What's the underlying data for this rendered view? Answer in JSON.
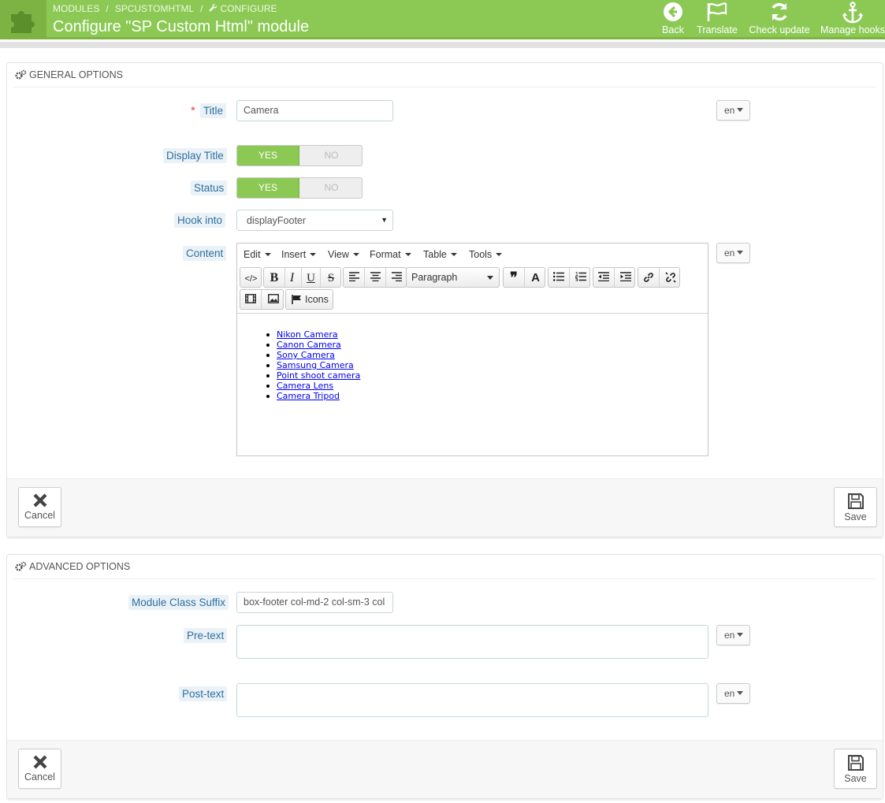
{
  "header": {
    "breadcrumb": [
      "MODULES",
      "SPCUSTOMHTML",
      "CONFIGURE"
    ],
    "title": "Configure \"SP Custom Html\" module",
    "actions": [
      {
        "label": "Back",
        "icon": "back-circle-icon"
      },
      {
        "label": "Translate",
        "icon": "flag-icon"
      },
      {
        "label": "Check update",
        "icon": "refresh-icon"
      },
      {
        "label": "Manage hooks",
        "icon": "anchor-icon"
      }
    ],
    "colors": {
      "bar": "#8bc954",
      "logo_bg": "#7cb342"
    }
  },
  "general": {
    "heading": "GENERAL OPTIONS",
    "title_label": "Title",
    "required_mark": "*",
    "title_value": "Camera",
    "lang": "en",
    "display_title_label": "Display Title",
    "status_label": "Status",
    "yes": "YES",
    "no": "NO",
    "hook_label": "Hook into",
    "hook_value": "displayFooter",
    "content_label": "Content",
    "editor": {
      "menu": [
        "Edit",
        "Insert",
        "View",
        "Format",
        "Table",
        "Tools"
      ],
      "format_select": "Paragraph",
      "icons_button": "Icons",
      "list": [
        "Nikon Camera",
        "Canon Camera",
        "Sony Camera",
        "Samsung Camera",
        "Point shoot camera",
        "Camera Lens",
        "Camera Tripod"
      ]
    },
    "cancel": "Cancel",
    "save": "Save"
  },
  "advanced": {
    "heading": "ADVANCED OPTIONS",
    "suffix_label": "Module Class Suffix",
    "suffix_value": "box-footer col-md-2 col-sm-3 col",
    "pretext_label": "Pre-text",
    "posttext_label": "Post-text",
    "lang": "en",
    "cancel": "Cancel",
    "save": "Save"
  }
}
